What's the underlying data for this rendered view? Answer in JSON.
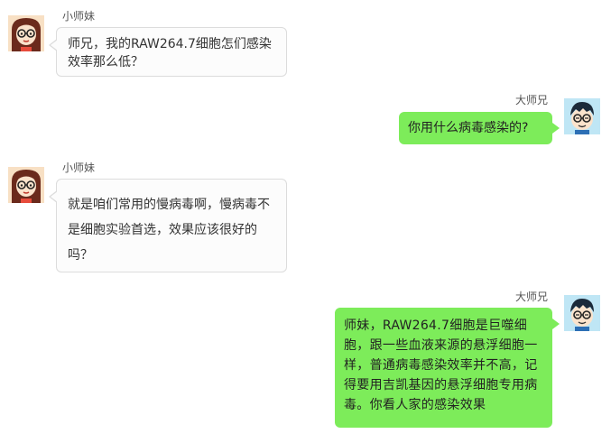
{
  "colors": {
    "right_bubble": "#7dec5a",
    "left_bubble": "#fcfcfc",
    "left_bubble_border": "#dcdcdc"
  },
  "messages": [
    {
      "side": "left",
      "sender": "小师妹",
      "avatar_icon": "girl-with-glasses-avatar",
      "text": "师兄，我的RAW264.7细胞怎们感染效率那么低？"
    },
    {
      "side": "right",
      "sender": "大师兄",
      "avatar_icon": "boy-with-glasses-avatar",
      "text": "你用什么病毒感染的?"
    },
    {
      "side": "left",
      "sender": "小师妹",
      "avatar_icon": "girl-with-glasses-avatar",
      "text": "就是咱们常用的慢病毒啊，慢病毒不是细胞实验首选，效果应该很好的吗？"
    },
    {
      "side": "right",
      "sender": "大师兄",
      "avatar_icon": "boy-with-glasses-avatar",
      "text": "师妹，RAW264.7细胞是巨噬细胞，跟一些血液来源的悬浮细胞一样，普通病毒感染效率并不高，记得要用吉凯基因的悬浮细胞专用病毒。你看人家的感染效果"
    }
  ]
}
